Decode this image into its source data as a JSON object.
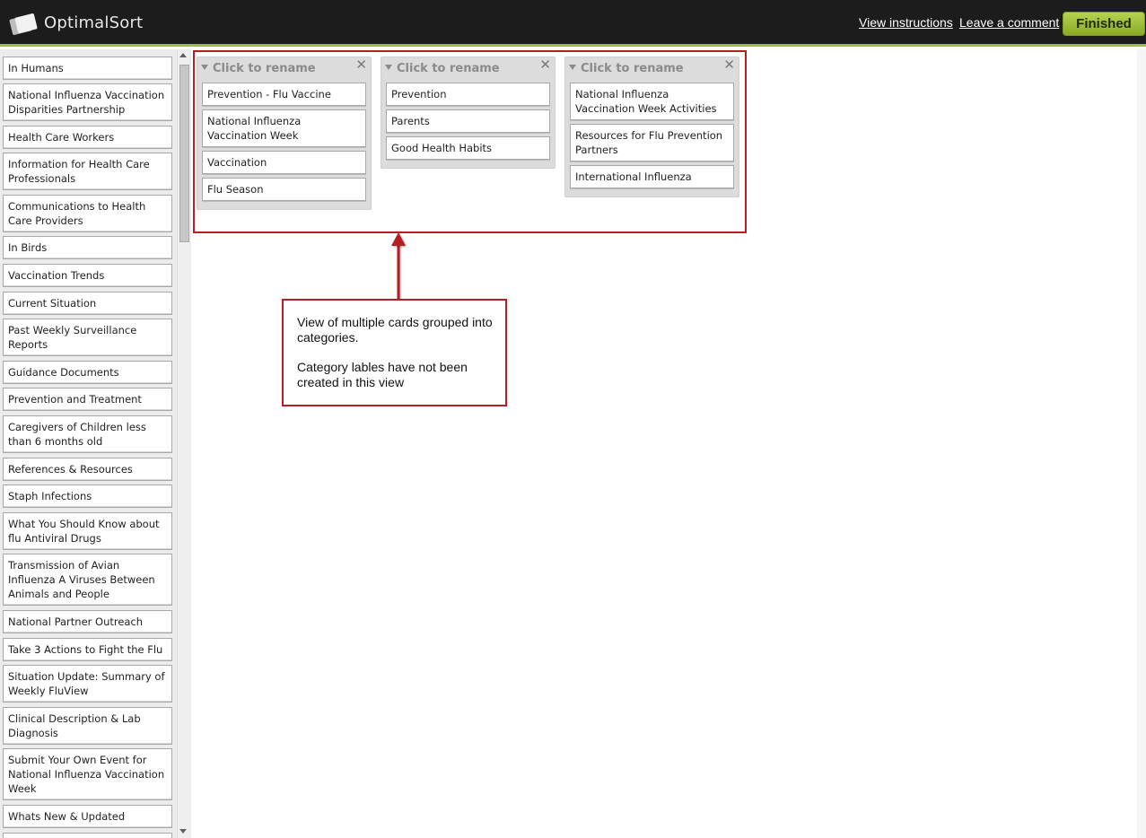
{
  "header": {
    "logo_text": "OptimalSort",
    "view_instructions": "View instructions",
    "leave_comment": "Leave a comment",
    "finished": "Finished"
  },
  "sidebar": {
    "cards": [
      "In Humans",
      "National Influenza Vaccination Disparities Partnership",
      "Health Care Workers",
      "Information for Health Care Professionals",
      "Communications to Health Care Providers",
      "In Birds",
      "Vaccination Trends",
      "Current Situation",
      "Past Weekly Surveillance Reports",
      "Guidance Documents",
      "Prevention and Treatment",
      "Caregivers of Children less than 6 months old",
      "References & Resources",
      "Staph Infections",
      "What You Should Know about flu Antiviral Drugs",
      "Transmission of Avian Influenza A Viruses Between Animals and People",
      "National Partner Outreach",
      "Take 3 Actions to Fight the Flu",
      "Situation Update: Summary of Weekly FluView",
      "Clinical Description & Lab Diagnosis",
      "Submit Your Own Event for National Influenza Vaccination Week",
      "Whats New & Updated"
    ]
  },
  "groups": [
    {
      "title": "Click to rename",
      "cards": [
        "Prevention - Flu Vaccine",
        "National Influenza Vaccination Week",
        "Vaccination",
        "Flu Season"
      ]
    },
    {
      "title": "Click to rename",
      "cards": [
        "Prevention",
        "Parents",
        "Good Health Habits"
      ]
    },
    {
      "title": "Click to rename",
      "cards": [
        "National Influenza Vaccination Week Activities",
        "Resources for Flu Prevention Partners",
        "International Influenza"
      ]
    }
  ],
  "annotation": {
    "line1": "View of multiple cards grouped into categories.",
    "line2": "Category lables have not been created in this view"
  },
  "colors": {
    "header_bg": "#1c1c1c",
    "accent_green": "#9dbf3a",
    "annotation_red": "#b51f24"
  }
}
